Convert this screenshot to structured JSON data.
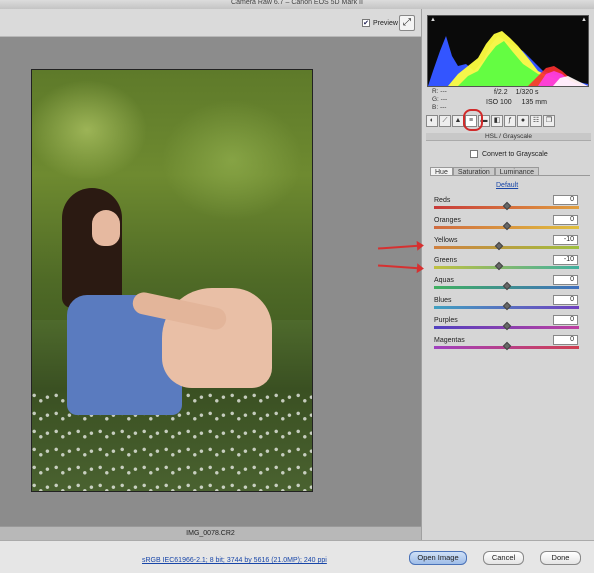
{
  "window": {
    "title": "Camera Raw 6.7  –  Canon EOS 5D Mark II"
  },
  "toolbar": {
    "preview_label": "Preview",
    "preview_checked": "✔"
  },
  "image": {
    "filename": "IMG_0078.CR2"
  },
  "readout": {
    "r": "R:  ---",
    "g": "G:  ---",
    "b": "B:  ---"
  },
  "camera": {
    "aperture": "f/2.2",
    "shutter": "1/320 s",
    "iso": "ISO 100",
    "focal": "135 mm"
  },
  "panel": {
    "header": "HSL / Grayscale",
    "convert_label": "Convert to Grayscale",
    "subtabs": [
      "Hue",
      "Saturation",
      "Luminance"
    ],
    "default_label": "Default",
    "sliders": [
      {
        "label": "Reds",
        "value": "0",
        "frac": 0.5,
        "colors": [
          "#c83a3a",
          "#e0a040"
        ]
      },
      {
        "label": "Oranges",
        "value": "0",
        "frac": 0.5,
        "colors": [
          "#d06a40",
          "#e0c040"
        ]
      },
      {
        "label": "Yellows",
        "value": "-10",
        "frac": 0.45,
        "colors": [
          "#d08040",
          "#a0c040"
        ]
      },
      {
        "label": "Greens",
        "value": "-10",
        "frac": 0.45,
        "colors": [
          "#c0c040",
          "#40b0a0"
        ]
      },
      {
        "label": "Aquas",
        "value": "0",
        "frac": 0.5,
        "colors": [
          "#40b060",
          "#4070c0"
        ]
      },
      {
        "label": "Blues",
        "value": "0",
        "frac": 0.5,
        "colors": [
          "#40a0c0",
          "#7040c0"
        ]
      },
      {
        "label": "Purples",
        "value": "0",
        "frac": 0.5,
        "colors": [
          "#5040c0",
          "#c040a0"
        ]
      },
      {
        "label": "Magentas",
        "value": "0",
        "frac": 0.5,
        "colors": [
          "#a040c0",
          "#d04050"
        ]
      }
    ]
  },
  "status": {
    "workflow": "sRGB IEC61966-2.1; 8 bit; 3744 by 5616 (21.0MP); 240 ppi"
  },
  "buttons": {
    "open": "Open Image",
    "cancel": "Cancel",
    "done": "Done"
  }
}
